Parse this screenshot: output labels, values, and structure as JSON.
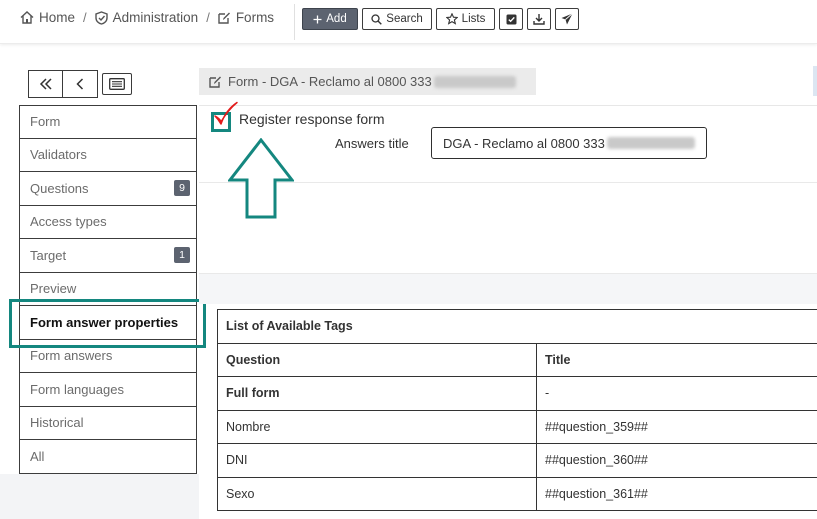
{
  "breadcrumb": [
    {
      "label": "Home",
      "icon": "home-icon"
    },
    {
      "label": "Administration",
      "icon": "shield-icon"
    },
    {
      "label": "Forms",
      "icon": "edit-icon"
    }
  ],
  "breadcrumb_separator": "/",
  "toolbar": {
    "add_label": "Add",
    "search_label": "Search",
    "lists_label": "Lists",
    "icons": [
      "check-square-icon",
      "download-icon",
      "send-icon"
    ]
  },
  "form_title": "Form - DGA - Reclamo al 0800 333",
  "sidebar": {
    "items": [
      {
        "label": "Form"
      },
      {
        "label": "Validators"
      },
      {
        "label": "Questions",
        "badge": "9"
      },
      {
        "label": "Access types"
      },
      {
        "label": "Target",
        "badge": "1"
      },
      {
        "label": "Preview"
      },
      {
        "label": "Form answer properties",
        "active": true
      },
      {
        "label": "Form answers"
      },
      {
        "label": "Form languages"
      },
      {
        "label": "Historical"
      },
      {
        "label": "All"
      }
    ]
  },
  "register": {
    "label": "Register response form",
    "checked": true
  },
  "answers_title": {
    "label": "Answers title",
    "value": "DGA - Reclamo al 0800 333"
  },
  "tags_table": {
    "caption": "List of Available Tags",
    "headers": [
      "Question",
      "Title"
    ],
    "rows": [
      {
        "question": "Full form",
        "title": "-",
        "bold": true
      },
      {
        "question": "Nombre",
        "title": "##question_359##"
      },
      {
        "question": "DNI",
        "title": "##question_360##"
      },
      {
        "question": "Sexo",
        "title": "##question_361##"
      }
    ]
  },
  "colors": {
    "teal_annotation": "#14877f",
    "check_red": "#e21b1b",
    "badge_gray": "#5c6370"
  }
}
